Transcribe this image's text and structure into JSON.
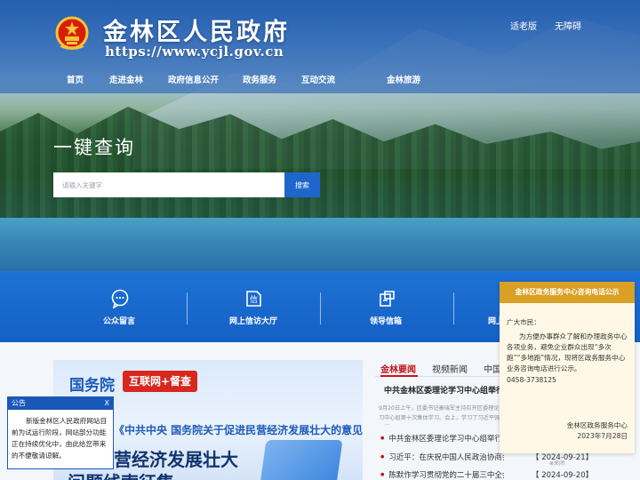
{
  "header": {
    "site_name": "金林区人民政府",
    "site_url": "https://www.ycjl.gov.cn",
    "links": [
      "适老版",
      "无障碍"
    ]
  },
  "nav": {
    "items": [
      "首页",
      "走进金林",
      "政府信息公开",
      "政务服务",
      "互动交流",
      "金林旅游"
    ]
  },
  "search": {
    "title": "一键查询",
    "placeholder": "请输入关键字",
    "button": "搜索"
  },
  "services": [
    {
      "label": "公众留言",
      "icon": "chat-bubble-icon"
    },
    {
      "label": "网上信访大厅",
      "icon": "letter-icon"
    },
    {
      "label": "领导信箱",
      "icon": "mailbox-icon"
    },
    {
      "label": "网上",
      "icon": "document-icon"
    }
  ],
  "banner": {
    "org": "国务院",
    "tag": "互联网+督查",
    "subtitle": "《中共中央 国务院关于促进民营经济发展壮大的意见》",
    "headline1": "营经济发展壮大",
    "headline2": "问题线索征集"
  },
  "news": {
    "tabs": [
      "金林要闻",
      "视频新闻",
      "中国"
    ],
    "active_tab": "金林要闻",
    "headline": "中共金林区委理论学习中心组举行",
    "summary": "9月20日上午，区委书记秦瑞军主持召开区委理论学习中心组第十次集体学习。会上，学习了习近平强军思想…",
    "items": [
      {
        "title": "中共金林区委理论学习中心组举行…",
        "date": ""
      },
      {
        "title": "习近平：在庆祝中国人民政治协商会…",
        "date": "【 2024-09-21】"
      },
      {
        "title": "陈默作学习贯彻党的二十届三中全会…",
        "date": "【 2024-09-20】"
      }
    ]
  },
  "popup": {
    "title": "金林区政务服务中心咨询电话公示",
    "greeting": "广大市民：",
    "text": "为方便办事群众了解和办理政务中心各项业务，避免企业群众出现“多次跑”“多地跑”情况，现将区政务服务中心业务咨询电话进行公示。",
    "phone": "0458-3738125",
    "signature": "金林区政务服务中心",
    "date": "2023年7月28日",
    "close": "⊗关闭"
  },
  "notice": {
    "title": "公告",
    "close": "X",
    "text": "新版金林区人民政府网站目前为试运行阶段，网站部分功能正在持续优化中，由此给您带来的不便敬请谅解。"
  },
  "colors": {
    "primary_blue": "#1d72d6",
    "accent_red": "#c4161c",
    "popup_gold": "#d9a024"
  }
}
